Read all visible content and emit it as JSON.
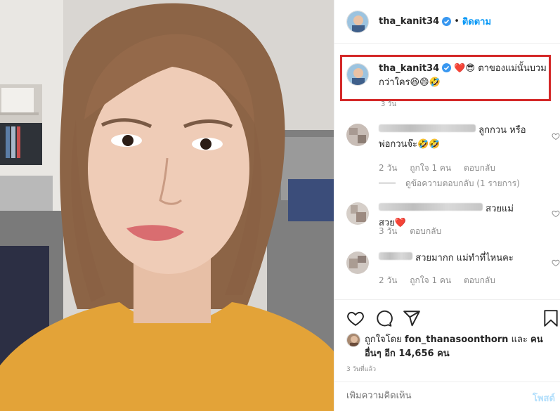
{
  "post": {
    "username": "tha_kanit34",
    "separator": "•",
    "follow_label": "ติดตาม",
    "caption_text": "❤️😎 ตาของแม่นั้นบวมกว่าใคร😆😄🤣",
    "caption_time": "3 วัน",
    "likes_prefix": "ถูกใจโดย ",
    "likes_user": "fon_thanasoonthorn",
    "likes_and": " และ ",
    "likes_others": "คนอื่นๆ อีก 14,656 คน",
    "post_time": "3 วันที่แล้ว",
    "add_comment_placeholder": "เพิ่มความคิดเห็น",
    "post_button": "โพสต์"
  },
  "comments": [
    {
      "text": "ลูกกวน หรือพ่อกวนจ๊ะ🤣🤣",
      "time": "2 วัน",
      "likes": "ถูกใจ 1 คน",
      "reply": "ตอบกลับ",
      "view_replies": "ดูข้อความตอบกลับ (1 รายการ)"
    },
    {
      "text": "สวยแม่สวย❤️",
      "time": "3 วัน",
      "reply": "ตอบกลับ"
    },
    {
      "text": "สวยมากก แม่ทำที่ไหนคะ",
      "time": "2 วัน",
      "likes": "ถูกใจ 1 คน",
      "reply": "ตอบกลับ"
    }
  ],
  "icons": [
    "verified-badge-icon",
    "heart-icon",
    "comment-icon",
    "share-icon",
    "bookmark-icon",
    "small-heart-icon"
  ],
  "colors": {
    "accent": "#0095f6",
    "highlight_box": "#d42828",
    "muted": "#8e8e8e",
    "post_disabled": "#b2dffc"
  }
}
